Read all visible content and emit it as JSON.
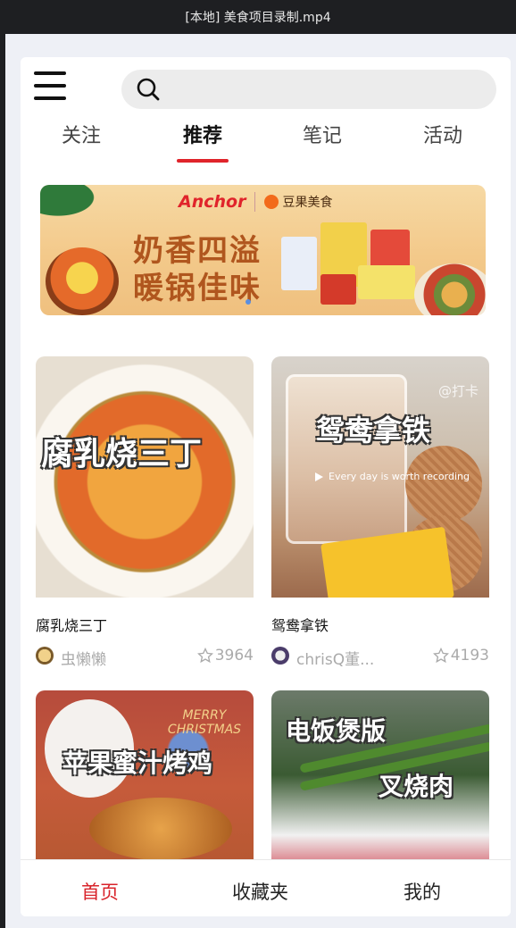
{
  "window": {
    "title": "[本地] 美食项目录制.mp4"
  },
  "header": {
    "menu_icon": "hamburger-menu-icon",
    "search": {
      "icon": "search-icon",
      "placeholder": ""
    }
  },
  "tabs": [
    {
      "label": "关注",
      "active": false
    },
    {
      "label": "推荐",
      "active": true
    },
    {
      "label": "笔记",
      "active": false
    },
    {
      "label": "活动",
      "active": false
    }
  ],
  "banner": {
    "brand_primary": "Anchor",
    "brand_secondary": "豆果美食",
    "line1": "奶香四溢",
    "line2": "暖锅佳味"
  },
  "feed": [
    {
      "title": "腐乳烧三丁",
      "overlay_title": "腐乳烧三丁",
      "author": "虫懒懒",
      "likes": "3964",
      "like_icon": "star-outline-icon"
    },
    {
      "title": "鸳鸯拿铁",
      "overlay_title": "鸳鸯拿铁",
      "watermark": "@打卡",
      "video_caption": "Every day is worth recording",
      "author": "chrisQ董...",
      "likes": "4193",
      "like_icon": "star-outline-icon"
    },
    {
      "overlay_title": "苹果蜜汁烤鸡",
      "overlay_subtitle": "MERRY CHRISTMAS"
    },
    {
      "overlay_title": "电饭煲版",
      "overlay_title2": "叉烧肉"
    }
  ],
  "bottom_nav": [
    {
      "label": "首页",
      "active": true
    },
    {
      "label": "收藏夹",
      "active": false
    },
    {
      "label": "我的",
      "active": false
    }
  ],
  "colors": {
    "accent": "#e0242b",
    "nav_active": "#d8232a",
    "text_primary": "#111111",
    "text_muted": "#aaaaaa",
    "search_bg": "#ececec",
    "page_bg": "#eef0f6"
  }
}
